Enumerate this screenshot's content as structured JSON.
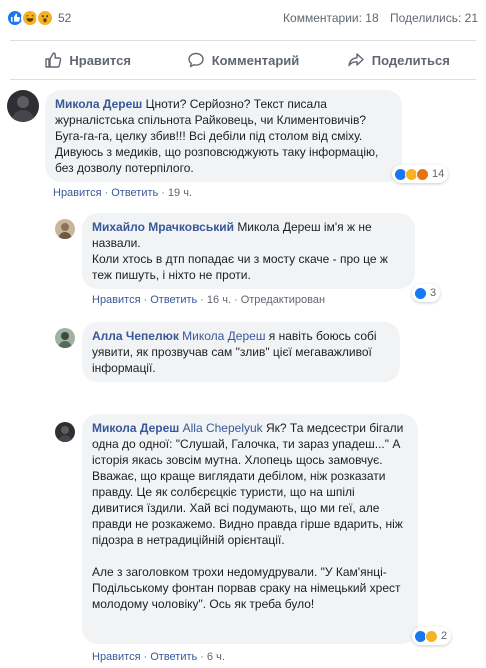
{
  "summary": {
    "reactions": [
      "like-icon",
      "haha-icon",
      "wow-icon"
    ],
    "reaction_count": "52",
    "comments": "Комментарии: 18",
    "shares": "Поделились: 21"
  },
  "actions": {
    "like": "Нравится",
    "comment": "Комментарий",
    "share": "Поделиться"
  },
  "comments": [
    {
      "author": "Микола Дереш",
      "text": "Цноти? Серйозно? Текст писала журналістська спільнота Райковець, чи Климентовичів? Буга-га-га, целку збив!!! Всі дебіли під столом від сміху. Дивуюсь з медиків, що розповсюджують таку інформацію, без дозволу потерпілого.",
      "like": "Нравится",
      "reply": "Ответить",
      "time": "19 ч.",
      "reactions": [
        "like-icon",
        "haha-icon",
        "angry-icon"
      ],
      "reaction_count": "14"
    },
    {
      "author": "Михайло Мрачковський",
      "mention": "",
      "line1": "Микола Дереш ім'я ж не назвали.",
      "line2": "Коли хтось в дтп попадає чи з мосту скаче - про це ж теж пишуть, і ніхто не проти.",
      "like": "Нравится",
      "reply": "Ответить",
      "time": "16 ч.",
      "edited": "Отредактирован",
      "reactions": [
        "like-icon"
      ],
      "reaction_count": "3"
    },
    {
      "author": "Алла Чепелюк",
      "mention": "Микола Дереш",
      "text": "я навіть боюсь собі уявити, як прозвучав сам \"злив\" цієї мегаважливої інформації."
    },
    {
      "author": "Микола Дереш",
      "mention": "Alla Chepelyuk",
      "para1": "Як? Та медсестри бігали одна до одної: \"Слушай, Галочка, ти зараз упадеш...\" А історія якась зовсім мутна. Хлопець щось замовчує. Вважає, що краще виглядати дебілом, ніж розказати правду. Це як солбєрєцкіє туристи, що на шпілі дивитися їздили. Хай всі подумають, що ми геї, але правди не розкажемо. Видно правда гірше вдарить, ніж підозра в нетрадиційній орієнтації.",
      "para2": "Але з заголовком трохи недомудрували. \"У Кам'янці-Подільському фонтан порвав сраку на німецький хрест молодому чоловіку\". Ось як треба було!",
      "like": "Нравится",
      "reply": "Ответить",
      "time": "6 ч.",
      "reactions": [
        "like-icon",
        "haha-icon"
      ],
      "reaction_count": "2"
    }
  ]
}
